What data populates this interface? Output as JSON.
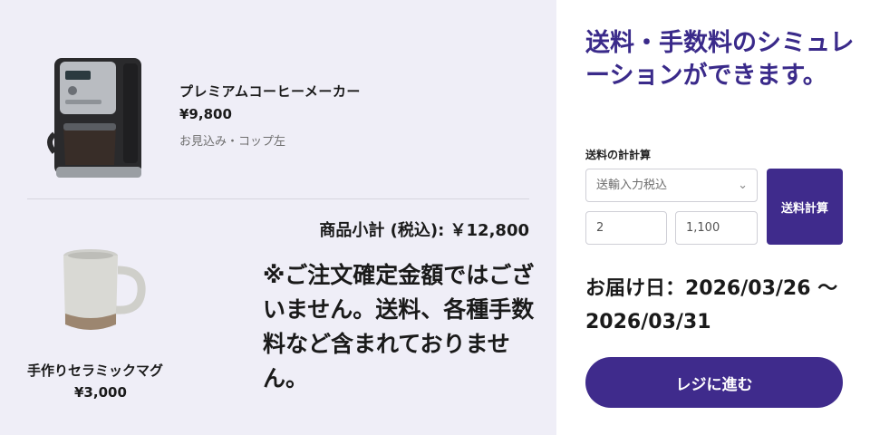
{
  "cart": {
    "items": [
      {
        "name": "プレミアムコーヒーメーカー",
        "price": "¥9,800",
        "option": "お見込み・コップ左",
        "image_icon": "coffee-maker-icon"
      },
      {
        "name": "手作りセラミックマグ",
        "price": "¥3,000",
        "image_icon": "mug-icon"
      }
    ],
    "subtotal": "商品小計 (税込): ￥12,800",
    "notice": "※ご注文確定金額ではございません。送料、各種手数料など含まれておりません。"
  },
  "simulation": {
    "title": "送料・手数料のシミュレーションができます。",
    "calc_label": "送料の計計算",
    "select_value": "送輸入力税込",
    "input_quantity": "2",
    "input_amount": "1,100",
    "calc_button": "送料計算",
    "delivery": "お届け日：2026/03/26 〜 2026/03/31",
    "checkout_button": "レジに進む"
  },
  "colors": {
    "accent": "#3f2b8c",
    "title": "#3a2a8a",
    "left_bg": "#efeef7"
  }
}
